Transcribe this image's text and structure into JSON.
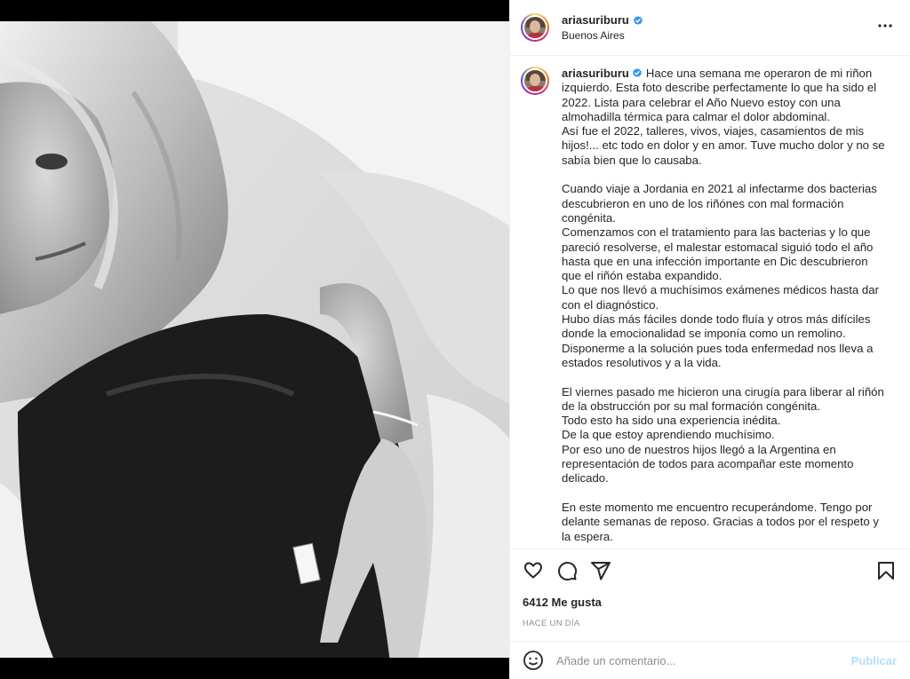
{
  "post": {
    "username": "ariasuriburu",
    "location": "Buenos Aires",
    "caption": "Hace una semana me operaron de mi riñon izquierdo. Esta foto describe perfectamente lo que ha sido el 2022. Lista para celebrar el Año Nuevo estoy con una almohadilla térmica para calmar el dolor abdominal.\nAsí fue el 2022, talleres, vivos, viajes, casamientos de mis hijos!... etc todo en dolor y en amor. Tuve mucho dolor y no se sabía bien que lo causaba.\n\nCuando viaje a Jordania en 2021 al infectarme dos bacterias descubrieron en uno de los riñónes con mal formación congénita.\nComenzamos con el tratamiento para las bacterias y lo que pareció resolverse, el malestar estomacal siguió todo el año hasta que en una infección importante en Dic descubrieron que el riñón estaba expandido.\nLo que nos llevó a muchísimos exámenes médicos hasta dar con el diagnóstico.\nHubo días más fáciles donde todo fluía y otros más difíciles donde la emocionalidad se imponía como un remolino.\nDisponerme a la solución pues toda enfermedad nos lleva a estados resolutivos y a la vida.\n\nEl viernes pasado me hicieron una cirugía para liberar al riñón de la obstrucción por su mal formación congénita.\nTodo esto ha sido una experiencia inédita.\nDe la que estoy aprendiendo muchísimo.\nPor eso uno de nuestros hijos llegó a la Argentina en representación de todos para acompañar este momento delicado.\n\nEn este momento me encuentro recuperándome. Tengo por delante semanas de reposo. Gracias a todos por el respeto y la espera.",
    "likes": "6412 Me gusta",
    "time": "HACE UN DÍA"
  },
  "comment_box": {
    "placeholder": "Añade un comentario...",
    "publish_label": "Publicar"
  },
  "icons": {
    "more": "more-icon",
    "verified": "verified-badge-icon",
    "like": "heart-icon",
    "comment": "comment-icon",
    "share": "send-icon",
    "save": "bookmark-icon",
    "emoji": "emoji-icon"
  },
  "colors": {
    "verified": "#3897f0",
    "publish_disabled": "#b2dffc",
    "muted": "#8e8e8e"
  }
}
